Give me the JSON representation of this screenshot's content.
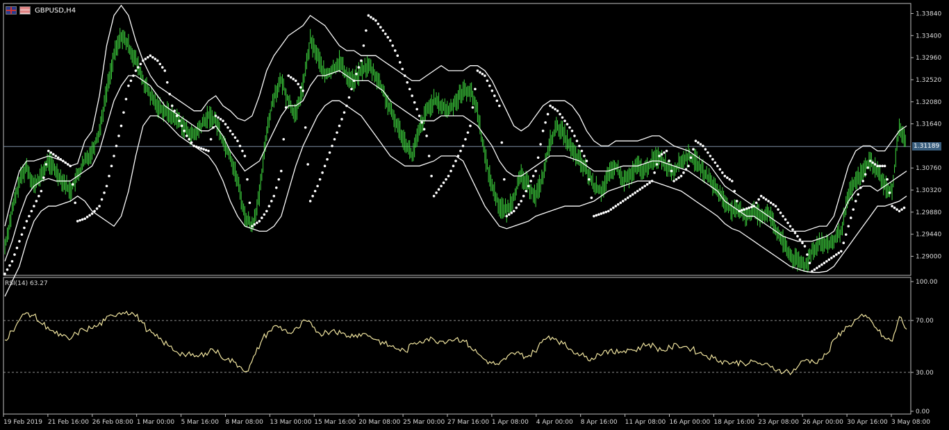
{
  "header": {
    "symbol": "GBPUSD,H4",
    "rsi_label": "RSI(14) 63.27",
    "current_price": "1.31189"
  },
  "colors": {
    "background": "#000000",
    "candles": "#3fd93f",
    "bands": "#ffffff",
    "sar": "#ffffff",
    "rsi": "#f2e6a0",
    "grid_line": "#c0c0c0",
    "current_price_line": "#7f8fa6",
    "price_badge": "#3a5f7f"
  },
  "chart_data": [
    {
      "type": "line",
      "name": "price-chart",
      "ylim": [
        1.2862,
        1.3404
      ],
      "price_axis_ticks": [
        "1.33840",
        "1.33400",
        "1.32960",
        "1.32520",
        "1.32080",
        "1.31640",
        "1.30760",
        "1.30320",
        "1.29880",
        "1.29440",
        "1.29000"
      ],
      "time_axis_labels": [
        "19 Feb 2019",
        "21 Feb 16:00",
        "26 Feb 08:00",
        "1 Mar 00:00",
        "5 Mar 16:00",
        "8 Mar 08:00",
        "13 Mar 00:00",
        "15 Mar 16:00",
        "20 Mar 08:00",
        "25 Mar 00:00",
        "27 Mar 16:00",
        "1 Apr 08:00",
        "4 Apr 00:00",
        "8 Apr 16:00",
        "11 Apr 08:00",
        "16 Apr 00:00",
        "18 Apr 16:00",
        "23 Apr 08:00",
        "26 Apr 00:00",
        "30 Apr 16:00",
        "3 May 08:00"
      ],
      "current_price": 1.31189,
      "series": [
        {
          "name": "price",
          "values": [
            1.292,
            1.299,
            1.305,
            1.308,
            1.304,
            1.306,
            1.309,
            1.307,
            1.305,
            1.303,
            1.306,
            1.309,
            1.311,
            1.315,
            1.323,
            1.33,
            1.334,
            1.332,
            1.329,
            1.325,
            1.322,
            1.32,
            1.319,
            1.318,
            1.317,
            1.315,
            1.314,
            1.316,
            1.318,
            1.317,
            1.313,
            1.31,
            1.305,
            1.298,
            1.296,
            1.302,
            1.315,
            1.322,
            1.325,
            1.321,
            1.318,
            1.324,
            1.333,
            1.33,
            1.326,
            1.327,
            1.329,
            1.326,
            1.325,
            1.327,
            1.328,
            1.326,
            1.323,
            1.319,
            1.316,
            1.313,
            1.31,
            1.315,
            1.319,
            1.321,
            1.32,
            1.319,
            1.321,
            1.323,
            1.323,
            1.319,
            1.31,
            1.304,
            1.3,
            1.299,
            1.302,
            1.306,
            1.304,
            1.302,
            1.306,
            1.313,
            1.316,
            1.314,
            1.311,
            1.309,
            1.307,
            1.304,
            1.303,
            1.306,
            1.308,
            1.305,
            1.306,
            1.308,
            1.307,
            1.309,
            1.31,
            1.308,
            1.307,
            1.309,
            1.31,
            1.309,
            1.307,
            1.305,
            1.303,
            1.301,
            1.299,
            1.299,
            1.298,
            1.299,
            1.298,
            1.299,
            1.295,
            1.293,
            1.29,
            1.289,
            1.288,
            1.291,
            1.293,
            1.292,
            1.293,
            1.295,
            1.302,
            1.305,
            1.307,
            1.309,
            1.307,
            1.304,
            1.303,
            1.316,
            1.3119
          ]
        },
        {
          "name": "upper-band",
          "values": [
            1.296,
            1.302,
            1.307,
            1.309,
            1.309,
            1.3095,
            1.31,
            1.3095,
            1.309,
            1.308,
            1.3085,
            1.313,
            1.315,
            1.322,
            1.332,
            1.338,
            1.34,
            1.338,
            1.333,
            1.329,
            1.326,
            1.324,
            1.323,
            1.322,
            1.321,
            1.32,
            1.319,
            1.319,
            1.321,
            1.322,
            1.32,
            1.319,
            1.3175,
            1.317,
            1.318,
            1.322,
            1.327,
            1.33,
            1.332,
            1.334,
            1.335,
            1.336,
            1.338,
            1.337,
            1.336,
            1.334,
            1.332,
            1.331,
            1.331,
            1.33,
            1.33,
            1.33,
            1.329,
            1.328,
            1.327,
            1.326,
            1.325,
            1.325,
            1.326,
            1.327,
            1.328,
            1.327,
            1.327,
            1.327,
            1.328,
            1.328,
            1.327,
            1.325,
            1.322,
            1.319,
            1.316,
            1.315,
            1.316,
            1.318,
            1.32,
            1.321,
            1.321,
            1.321,
            1.32,
            1.318,
            1.315,
            1.313,
            1.312,
            1.312,
            1.313,
            1.313,
            1.313,
            1.313,
            1.3135,
            1.314,
            1.314,
            1.313,
            1.312,
            1.3115,
            1.311,
            1.31,
            1.309,
            1.308,
            1.306,
            1.304,
            1.303,
            1.302,
            1.301,
            1.3,
            1.299,
            1.298,
            1.297,
            1.296,
            1.295,
            1.295,
            1.295,
            1.2955,
            1.296,
            1.296,
            1.298,
            1.303,
            1.308,
            1.311,
            1.312,
            1.312,
            1.311,
            1.311,
            1.313,
            1.315,
            1.316
          ]
        },
        {
          "name": "middle-band",
          "values": [
            1.289,
            1.293,
            1.298,
            1.302,
            1.304,
            1.305,
            1.3055,
            1.305,
            1.305,
            1.305,
            1.306,
            1.307,
            1.308,
            1.311,
            1.316,
            1.321,
            1.324,
            1.326,
            1.326,
            1.325,
            1.324,
            1.322,
            1.32,
            1.319,
            1.318,
            1.317,
            1.316,
            1.315,
            1.315,
            1.316,
            1.314,
            1.311,
            1.309,
            1.307,
            1.308,
            1.309,
            1.312,
            1.315,
            1.318,
            1.32,
            1.32,
            1.321,
            1.324,
            1.326,
            1.326,
            1.3265,
            1.327,
            1.326,
            1.325,
            1.325,
            1.325,
            1.324,
            1.323,
            1.321,
            1.32,
            1.319,
            1.318,
            1.317,
            1.317,
            1.317,
            1.318,
            1.318,
            1.318,
            1.318,
            1.317,
            1.316,
            1.314,
            1.312,
            1.309,
            1.307,
            1.306,
            1.306,
            1.307,
            1.308,
            1.309,
            1.31,
            1.31,
            1.31,
            1.3095,
            1.309,
            1.308,
            1.307,
            1.307,
            1.307,
            1.3075,
            1.308,
            1.308,
            1.308,
            1.3085,
            1.309,
            1.309,
            1.3085,
            1.308,
            1.3075,
            1.307,
            1.306,
            1.305,
            1.304,
            1.303,
            1.301,
            1.3,
            1.299,
            1.298,
            1.298,
            1.297,
            1.296,
            1.295,
            1.294,
            1.2935,
            1.293,
            1.293,
            1.293,
            1.2935,
            1.294,
            1.295,
            1.298,
            1.301,
            1.303,
            1.304,
            1.304,
            1.303,
            1.304,
            1.305,
            1.306,
            1.307
          ]
        },
        {
          "name": "lower-band",
          "values": [
            1.282,
            1.285,
            1.288,
            1.293,
            1.297,
            1.299,
            1.3,
            1.3,
            1.3005,
            1.301,
            1.302,
            1.301,
            1.299,
            1.298,
            1.297,
            1.296,
            1.298,
            1.303,
            1.31,
            1.316,
            1.318,
            1.318,
            1.317,
            1.3155,
            1.314,
            1.313,
            1.312,
            1.311,
            1.31,
            1.308,
            1.305,
            1.301,
            1.298,
            1.296,
            1.2955,
            1.295,
            1.295,
            1.296,
            1.298,
            1.303,
            1.308,
            1.312,
            1.315,
            1.318,
            1.32,
            1.321,
            1.321,
            1.32,
            1.319,
            1.318,
            1.316,
            1.314,
            1.312,
            1.31,
            1.309,
            1.308,
            1.308,
            1.308,
            1.3085,
            1.309,
            1.31,
            1.31,
            1.31,
            1.309,
            1.306,
            1.303,
            1.3,
            1.298,
            1.296,
            1.2955,
            1.296,
            1.2965,
            1.297,
            1.298,
            1.2985,
            1.299,
            1.2995,
            1.3,
            1.3,
            1.3,
            1.3005,
            1.301,
            1.302,
            1.303,
            1.3035,
            1.304,
            1.3045,
            1.305,
            1.305,
            1.305,
            1.3045,
            1.304,
            1.3035,
            1.303,
            1.302,
            1.301,
            1.3,
            1.299,
            1.298,
            1.2965,
            1.2955,
            1.295,
            1.294,
            1.293,
            1.292,
            1.291,
            1.29,
            1.289,
            1.288,
            1.2875,
            1.287,
            1.2868,
            1.2868,
            1.287,
            1.288,
            1.29,
            1.292,
            1.294,
            1.296,
            1.298,
            1.3,
            1.3,
            1.3005,
            1.301,
            1.302
          ]
        },
        {
          "name": "parabolic-sar",
          "values": [
            1.2865,
            1.289,
            1.293,
            1.297,
            1.3,
            1.303,
            1.311,
            1.31,
            1.309,
            1.308,
            1.297,
            1.2975,
            1.2985,
            1.3,
            1.304,
            1.31,
            1.316,
            1.324,
            1.327,
            1.329,
            1.33,
            1.329,
            1.327,
            1.32,
            1.317,
            1.314,
            1.312,
            1.3115,
            1.311,
            1.318,
            1.317,
            1.315,
            1.313,
            1.31,
            1.296,
            1.297,
            1.299,
            1.302,
            1.307,
            1.326,
            1.325,
            1.323,
            1.301,
            1.304,
            1.308,
            1.312,
            1.316,
            1.32,
            1.325,
            1.329,
            1.338,
            1.337,
            1.335,
            1.333,
            1.33,
            1.326,
            1.322,
            1.318,
            1.314,
            1.302,
            1.304,
            1.306,
            1.309,
            1.312,
            1.316,
            1.327,
            1.326,
            1.323,
            1.32,
            1.298,
            1.299,
            1.301,
            1.304,
            1.307,
            1.315,
            1.32,
            1.319,
            1.317,
            1.315,
            1.312,
            1.309,
            1.298,
            1.2985,
            1.299,
            1.3,
            1.301,
            1.302,
            1.303,
            1.304,
            1.305,
            1.31,
            1.311,
            1.305,
            1.306,
            1.308,
            1.313,
            1.312,
            1.31,
            1.308,
            1.306,
            1.305,
            1.299,
            1.2995,
            1.3,
            1.302,
            1.301,
            1.3,
            1.298,
            1.296,
            1.294,
            1.292,
            1.287,
            1.288,
            1.289,
            1.29,
            1.291,
            1.296,
            1.301,
            1.305,
            1.309,
            1.308,
            1.308,
            1.3,
            1.299,
            1.3
          ]
        }
      ]
    },
    {
      "type": "line",
      "name": "rsi-chart",
      "ylim": [
        0,
        100
      ],
      "ticks": [
        "100.00",
        "70.00",
        "30.00",
        "0.00"
      ],
      "levels": [
        70,
        30
      ],
      "series": [
        {
          "name": "RSI(14)",
          "values": [
            55,
            62,
            70,
            76,
            74,
            68,
            65,
            60,
            58,
            55,
            60,
            63,
            64,
            66,
            70,
            74,
            76,
            77,
            75,
            70,
            62,
            58,
            54,
            50,
            46,
            44,
            43,
            42,
            45,
            48,
            44,
            40,
            38,
            34,
            31,
            44,
            56,
            62,
            66,
            63,
            60,
            64,
            70,
            65,
            60,
            61,
            63,
            60,
            58,
            59,
            60,
            58,
            55,
            52,
            50,
            48,
            46,
            52,
            54,
            56,
            55,
            54,
            55,
            56,
            55,
            50,
            45,
            40,
            37,
            36,
            40,
            45,
            44,
            42,
            46,
            53,
            58,
            56,
            52,
            48,
            45,
            42,
            41,
            44,
            47,
            45,
            46,
            48,
            47,
            50,
            52,
            49,
            47,
            49,
            51,
            50,
            48,
            45,
            43,
            41,
            39,
            38,
            37,
            38,
            37,
            38,
            36,
            34,
            32,
            31,
            30,
            36,
            40,
            38,
            40,
            45,
            56,
            62,
            66,
            71,
            73,
            70,
            62,
            56,
            54,
            73,
            63.27
          ]
        }
      ]
    }
  ]
}
